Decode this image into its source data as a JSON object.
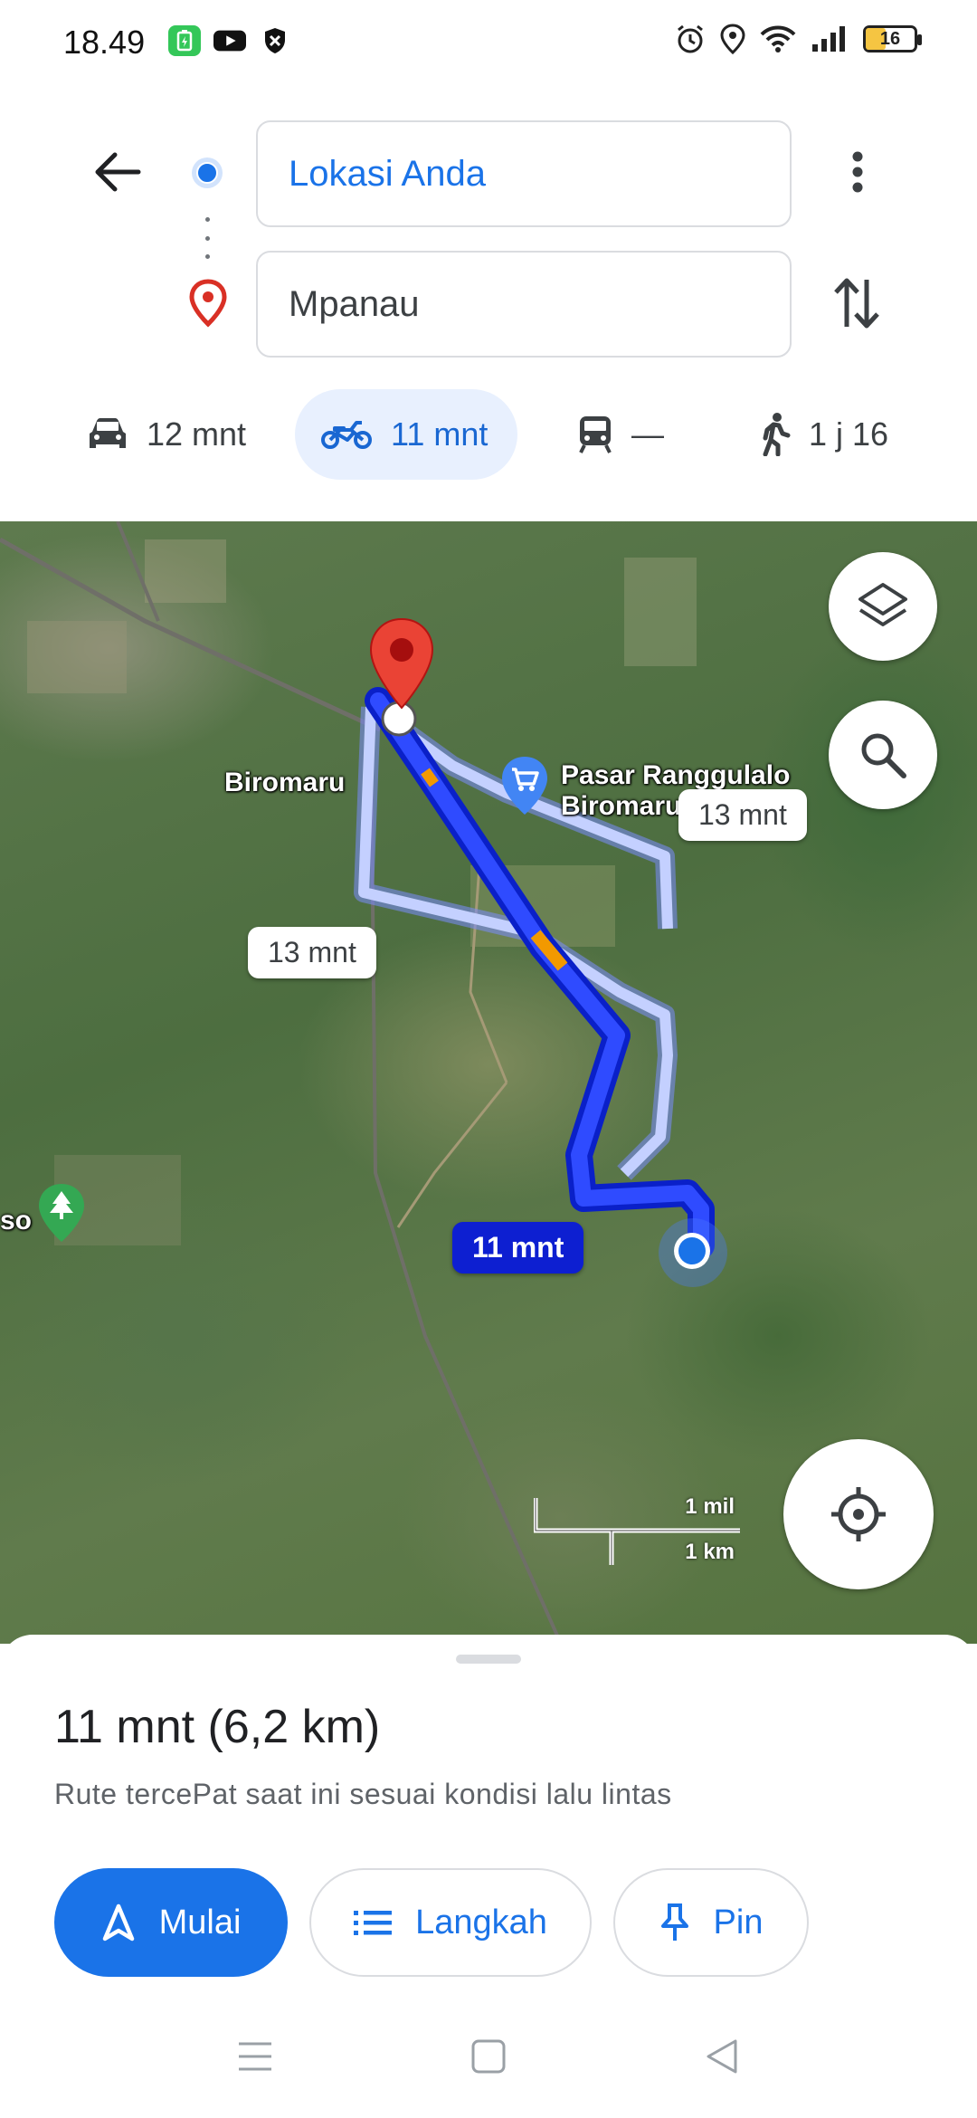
{
  "status_bar": {
    "time": "18.49",
    "battery": "16",
    "left_icons": [
      "battery-saver-icon",
      "youtube-icon",
      "shield-icon"
    ],
    "right_icons": [
      "alarm-icon",
      "location-icon",
      "wifi-icon",
      "signal-icon"
    ]
  },
  "directions": {
    "origin": "Lokasi Anda",
    "destination": "Mpanau"
  },
  "modes": [
    {
      "name": "car",
      "label": "12 mnt",
      "active": false
    },
    {
      "name": "motorcycle",
      "label": "11 mnt",
      "active": true
    },
    {
      "name": "transit",
      "label": "—",
      "active": false
    },
    {
      "name": "walk",
      "label": "1 j 16",
      "active": false
    }
  ],
  "map": {
    "places": {
      "biromaru": "Biromaru",
      "market_line1": "Pasar Ranggulalo",
      "market_line2": "Biromaru",
      "park_partial": "so"
    },
    "route_bubbles": {
      "alt_right": "13 mnt",
      "alt_left": "13 mnt",
      "selected": "11 mnt"
    },
    "scale": {
      "miles": "1 mil",
      "km": "1 km"
    },
    "colors": {
      "route": "#1f34f0",
      "alt_route": "#b7c6ff",
      "traffic": "#f29900"
    }
  },
  "sheet": {
    "summary": "11 mnt (6,2 km)",
    "note": "Rute tercePat saat ini sesuai kondisi lalu lintas",
    "buttons": {
      "start": "Mulai",
      "steps": "Langkah",
      "pin": "Pin"
    }
  }
}
